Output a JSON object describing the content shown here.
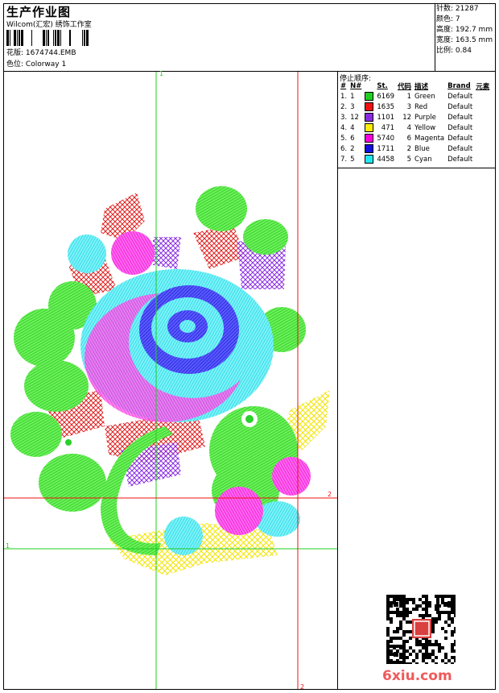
{
  "header": {
    "title": "生产作业图",
    "studio": "Wilcom(汇宏) 绣饰工作室",
    "design_label": "花版:",
    "design_value": "1674744.EMB",
    "colorway_label": "色位:",
    "colorway_value": "Colorway 1"
  },
  "stats": [
    {
      "label": "针数:",
      "value": "21287"
    },
    {
      "label": "颜色:",
      "value": "7"
    },
    {
      "label": "高度:",
      "value": "192.7 mm"
    },
    {
      "label": "宽度:",
      "value": "163.5 mm"
    },
    {
      "label": "比例:",
      "value": "0.84"
    }
  ],
  "stop_sequence": {
    "title": "停止顺序:",
    "columns": [
      "#",
      "N#",
      "St.",
      "代码",
      "描述",
      "Brand",
      "元素"
    ],
    "rows": [
      {
        "idx": "1.",
        "n": "1",
        "color": "#22cc22",
        "st": "6169",
        "code": "1",
        "desc": "Green",
        "brand": "Default"
      },
      {
        "idx": "2.",
        "n": "3",
        "color": "#ee1111",
        "st": "1635",
        "code": "3",
        "desc": "Red",
        "brand": "Default"
      },
      {
        "idx": "3.",
        "n": "12",
        "color": "#8a2be2",
        "st": "1101",
        "code": "12",
        "desc": "Purple",
        "brand": "Default"
      },
      {
        "idx": "4.",
        "n": "4",
        "color": "#ffee00",
        "st": "471",
        "code": "4",
        "desc": "Yellow",
        "brand": "Default"
      },
      {
        "idx": "5.",
        "n": "6",
        "color": "#ff00dd",
        "st": "5740",
        "code": "6",
        "desc": "Magenta",
        "brand": "Default"
      },
      {
        "idx": "6.",
        "n": "2",
        "color": "#1111dd",
        "st": "1711",
        "code": "2",
        "desc": "Blue",
        "brand": "Default"
      },
      {
        "idx": "7.",
        "n": "5",
        "color": "#22e6f0",
        "st": "4458",
        "code": "5",
        "desc": "Cyan",
        "brand": "Default"
      }
    ]
  },
  "guides": {
    "v1": "1",
    "h1": "1",
    "v2": "2",
    "h2": "2"
  },
  "colors": {
    "green_guide": "#22cc22",
    "red_guide": "#ee1111"
  },
  "watermark": {
    "site": "6xiu.com",
    "seal_icon": "red-seal-icon",
    "qr_icon": "qr-code-icon"
  }
}
